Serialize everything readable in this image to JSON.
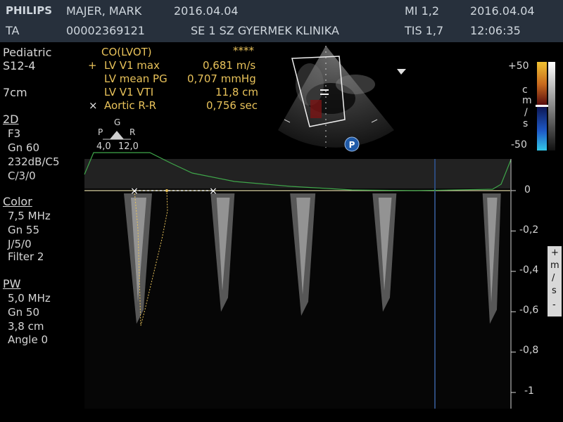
{
  "header": {
    "brand": "PHILIPS",
    "patient_name": "MAJER, MARK",
    "date_left": "2016.04.04",
    "mi": "MI 1,2",
    "date_right": "2016.04.04",
    "code": "TA",
    "patient_id": "00002369121",
    "institution": "SE 1 SZ GYERMEK KLINIKA",
    "tis": "TIS 1,7",
    "time": "12:06:35"
  },
  "left_panel": {
    "preset": "Pediatric",
    "probe": "S12-4",
    "depth": "7cm",
    "mode_2d": {
      "title": "2D",
      "lines": [
        "F3",
        "Gn 60",
        "232dB/C5",
        "C/3/0"
      ]
    },
    "color": {
      "title": "Color",
      "lines": [
        "7,5 MHz",
        "Gn 55",
        "J/5/0",
        "Filter 2"
      ]
    },
    "pw": {
      "title": "PW",
      "lines": [
        "5,0 MHz",
        "Gn 50",
        "3,8 cm",
        "Angle 0"
      ]
    }
  },
  "measurements": {
    "title": "CO(LVOT)",
    "stars": "****",
    "rows": [
      {
        "marker": "+",
        "label": "LV V1 max",
        "value": "0,681 m/s"
      },
      {
        "marker": "",
        "label": "LV mean PG",
        "value": "0,707 mmHg"
      },
      {
        "marker": "",
        "label": "LV V1 VTI",
        "value": "11,8 cm"
      },
      {
        "marker": "×",
        "label": "Aortic R-R",
        "value": "0,756 sec"
      }
    ]
  },
  "orientation": {
    "g": "G",
    "p": "P",
    "r": "R",
    "p_value": "4,0",
    "r_value": "12,0",
    "badge": "P"
  },
  "color_scale": {
    "top": "+50",
    "unit_chars": [
      "c",
      "m",
      "/",
      "s"
    ],
    "bottom": "-50"
  },
  "velocity_scale": {
    "ticks": [
      "0",
      "-0,2",
      "-0,4",
      "-0,6",
      "-0,8",
      "-1"
    ],
    "tick_values": [
      0,
      -0.2,
      -0.4,
      -0.6,
      -0.8,
      -1.0
    ],
    "side_label": [
      "+",
      "m",
      "/",
      "s",
      "-"
    ]
  },
  "colors": {
    "header_bg": "#27303c",
    "measure_text": "#e8c25a",
    "ecg": "#3fa64a",
    "baseline": "#d8cfa0"
  }
}
